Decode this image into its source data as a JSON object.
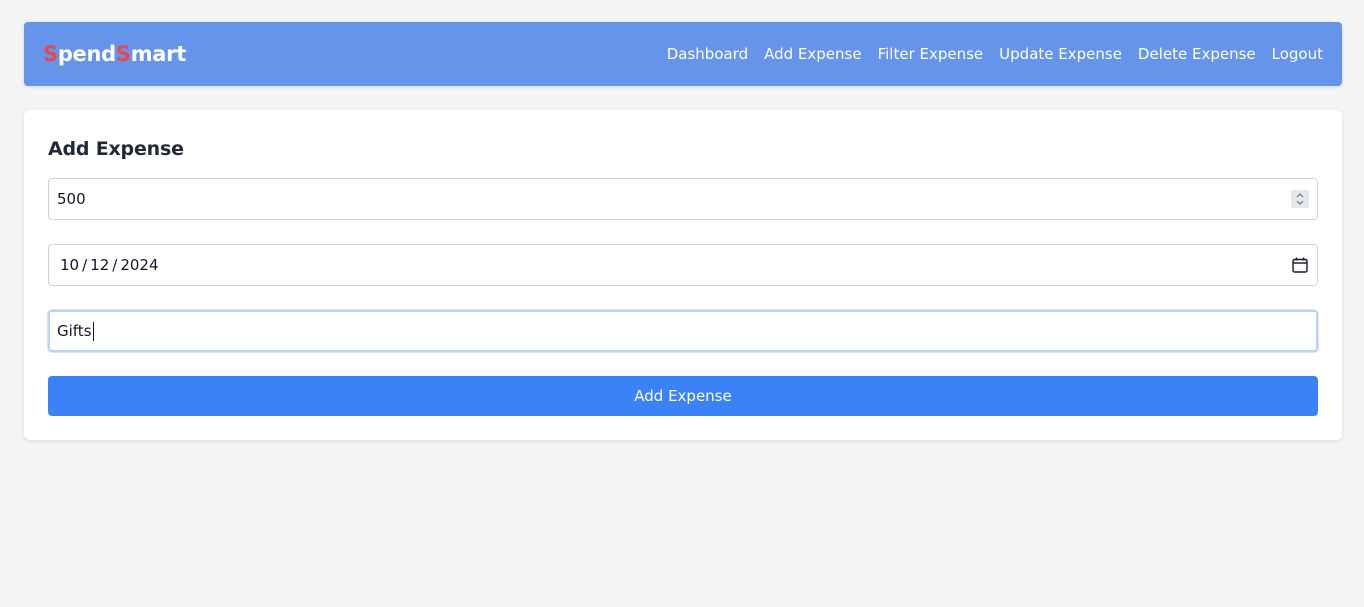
{
  "brand": {
    "first_initial": "S",
    "first_rest": "pend",
    "second_initial": "S",
    "second_rest": "mart"
  },
  "nav": {
    "items": [
      {
        "label": "Dashboard"
      },
      {
        "label": "Add Expense"
      },
      {
        "label": "Filter Expense"
      },
      {
        "label": "Update Expense"
      },
      {
        "label": "Delete Expense"
      },
      {
        "label": "Logout"
      }
    ]
  },
  "form": {
    "title": "Add Expense",
    "amount": {
      "value": "500"
    },
    "date": {
      "month": "10",
      "day": "12",
      "year": "2024",
      "separator": "/"
    },
    "category": {
      "value": "Gifts"
    },
    "submit_label": "Add Expense"
  },
  "colors": {
    "navbar": "#6694ea",
    "brand_accent": "#e5484d",
    "primary_button": "#3b82f6",
    "page_background": "#f3f4f6"
  },
  "icons": {
    "amount_stepper": "spinner-icon",
    "date_picker": "calendar-icon"
  }
}
